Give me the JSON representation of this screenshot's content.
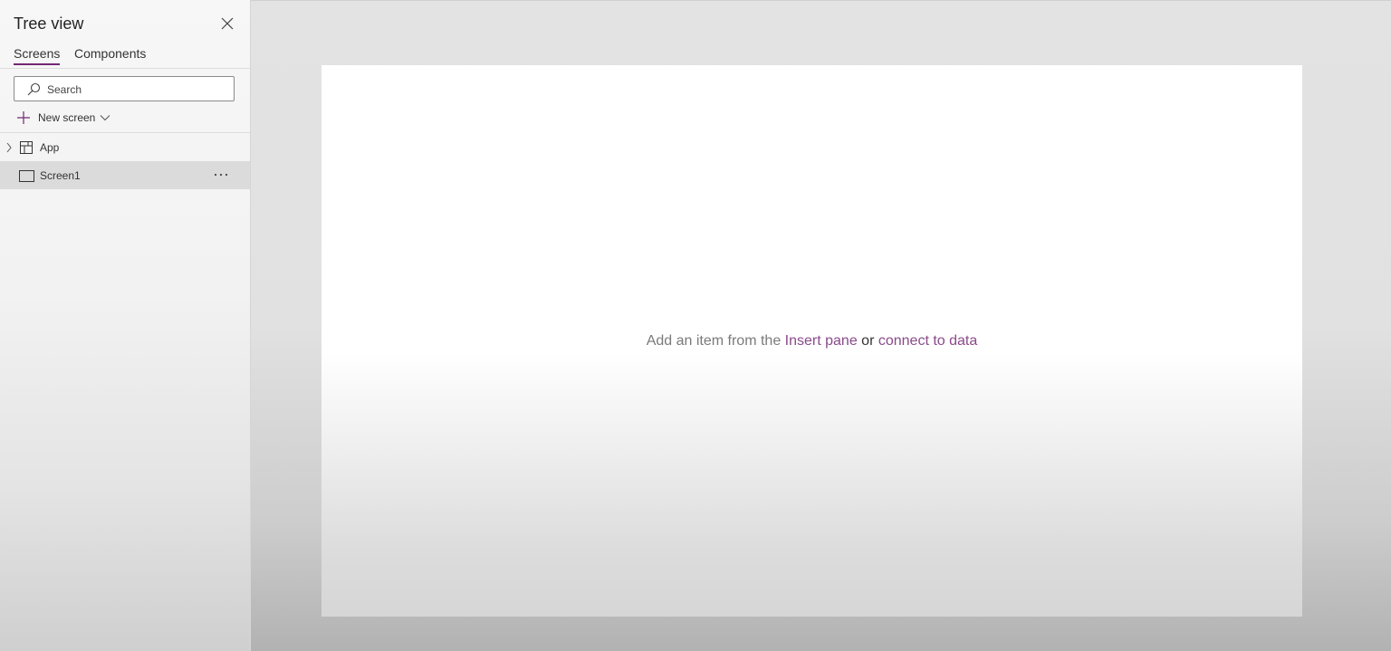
{
  "tree_view": {
    "title": "Tree view",
    "tabs": [
      {
        "label": "Screens",
        "active": true
      },
      {
        "label": "Components",
        "active": false
      }
    ],
    "search": {
      "placeholder": "Search"
    },
    "new_screen_label": "New screen",
    "items": [
      {
        "label": "App",
        "icon": "app-icon",
        "expandable": true
      },
      {
        "label": "Screen1",
        "icon": "screen-icon",
        "selected": true
      }
    ]
  },
  "canvas": {
    "hint": {
      "part1": "Add an item from the ",
      "link1": "Insert pane",
      "or": " or ",
      "link2": "connect to data"
    }
  },
  "colors": {
    "accent": "#742774",
    "link": "#8a4a8a"
  }
}
